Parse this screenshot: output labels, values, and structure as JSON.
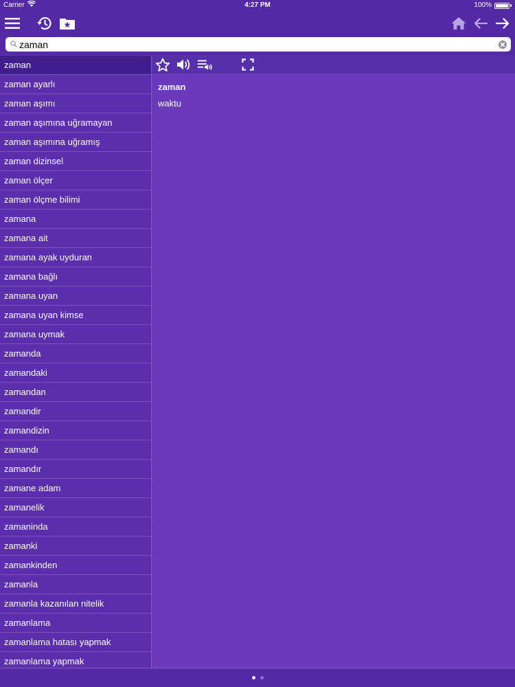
{
  "status": {
    "carrier": "Carrier",
    "time": "4:27 PM",
    "battery": "100%"
  },
  "toolbar": {
    "icons": [
      "menu-icon",
      "history-icon",
      "favorites-folder-icon",
      "home-icon",
      "back-arrow-icon",
      "forward-arrow-icon"
    ]
  },
  "search": {
    "value": "zaman"
  },
  "list": {
    "items": [
      "zaman",
      "zaman ayarlı",
      "zaman aşımı",
      "zaman aşımına uğramayan",
      "zaman aşımına uğramış",
      "zaman dizinsel",
      "zaman ölçer",
      "zaman ölçme bilimi",
      "zamana",
      "zamana ait",
      "zamana ayak uyduran",
      "zamana bağlı",
      "zamana uyan",
      "zamana uyan kimse",
      "zamana uymak",
      "zamanda",
      "zamandaki",
      "zamandan",
      "zamandir",
      "zamandizin",
      "zamandı",
      "zamandır",
      "zamane adam",
      "zamanelik",
      "zamaninda",
      "zamanki",
      "zamankinden",
      "zamanla",
      "zamanla kazanılan nitelik",
      "zamanlama",
      "zamanlama hatası yapmak",
      "zamanlama yapmak"
    ],
    "selected_index": 0
  },
  "detail": {
    "icons": [
      "star-icon",
      "speaker-icon",
      "playlist-speaker-icon",
      "fullscreen-icon"
    ],
    "word": "zaman",
    "definition": "waktu"
  },
  "pager": {
    "pages": 2,
    "current": 1
  },
  "colors": {
    "background": "#5b2eae",
    "bar": "#5329a6",
    "detail": "#6a3abd",
    "selected": "#3f1e8c"
  }
}
